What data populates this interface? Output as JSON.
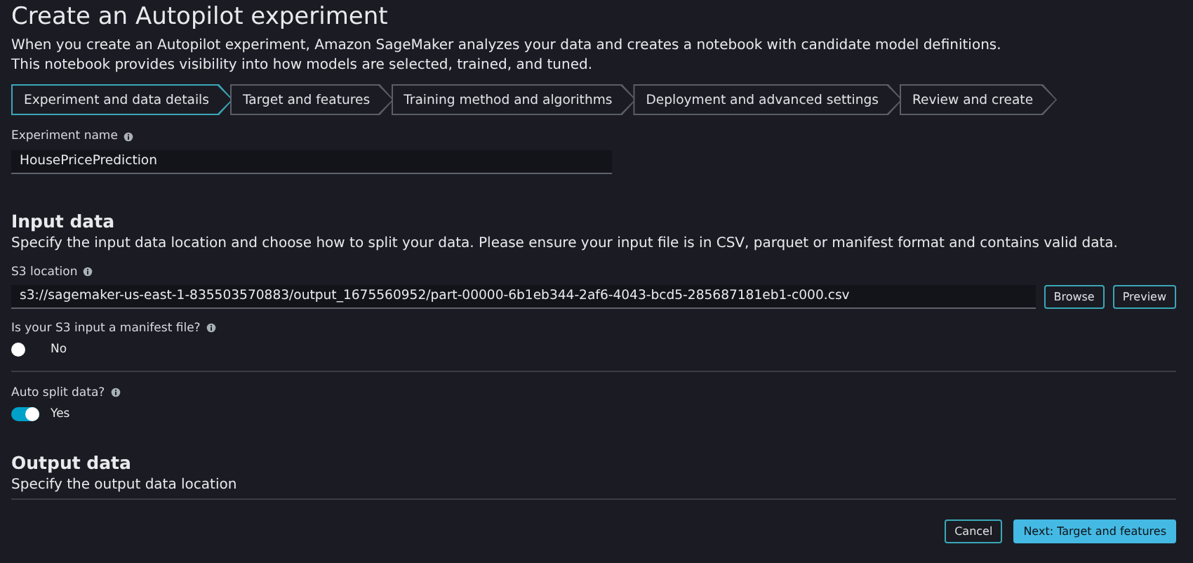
{
  "title": "Create an Autopilot experiment",
  "description": [
    "When you create an Autopilot experiment, Amazon SageMaker analyzes your data and creates a notebook with candidate model definitions.",
    "This notebook provides visibility into how models are selected, trained, and tuned."
  ],
  "steps": [
    {
      "label": "Experiment and data details",
      "selected": true
    },
    {
      "label": "Target and features",
      "selected": false
    },
    {
      "label": "Training method and algorithms",
      "selected": false
    },
    {
      "label": "Deployment and advanced settings",
      "selected": false
    },
    {
      "label": "Review and create",
      "selected": false
    }
  ],
  "experiment_name": {
    "label": "Experiment name",
    "value": "HousePricePrediction"
  },
  "input_data": {
    "heading": "Input data",
    "description": "Specify the input data location and choose how to split your data. Please ensure your input file is in CSV, parquet or manifest format and contains valid data.",
    "s3_location": {
      "label": "S3 location",
      "value": "s3://sagemaker-us-east-1-835503570883/output_1675560952/part-00000-6b1eb344-2af6-4043-bcd5-285687181eb1-c000.csv",
      "buttons": [
        "Browse",
        "Preview"
      ]
    },
    "manifest": {
      "label": "Is your S3 input a manifest file?",
      "on": false,
      "state_label": "No"
    },
    "auto_split": {
      "label": "Auto split data?",
      "on": true,
      "state_label": "Yes"
    }
  },
  "output_data": {
    "heading": "Output data",
    "description": "Specify the output data location"
  },
  "footer": {
    "cancel": "Cancel",
    "next": "Next: Target and features"
  }
}
